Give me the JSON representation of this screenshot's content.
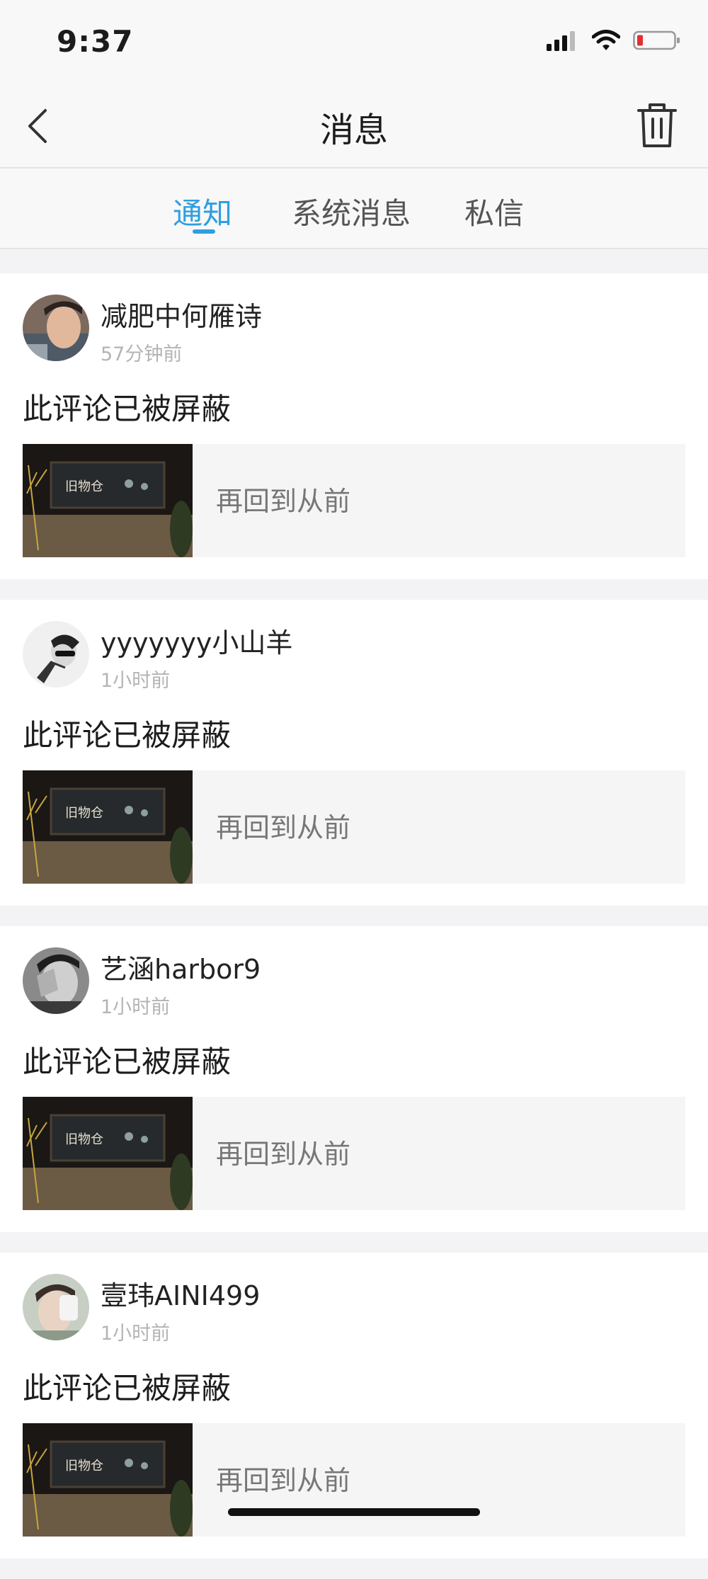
{
  "status_bar": {
    "time": "9:37"
  },
  "nav": {
    "title": "消息"
  },
  "tabs": [
    {
      "label": "通知",
      "active": true
    },
    {
      "label": "系统消息",
      "active": false
    },
    {
      "label": "私信",
      "active": false
    }
  ],
  "notifications": [
    {
      "user": "减肥中何雁诗",
      "time": "57分钟前",
      "content": "此评论已被屏蔽",
      "quote": "再回到从前"
    },
    {
      "user": "yyyyyyy小山羊",
      "time": "1小时前",
      "content": "此评论已被屏蔽",
      "quote": "再回到从前"
    },
    {
      "user": "艺涵harbor9",
      "time": "1小时前",
      "content": "此评论已被屏蔽",
      "quote": "再回到从前"
    },
    {
      "user": "壹玮AINI499",
      "time": "1小时前",
      "content": "此评论已被屏蔽",
      "quote": "再回到从前"
    }
  ],
  "colors": {
    "accent": "#2d9fe0",
    "battery_low": "#e0312f"
  }
}
